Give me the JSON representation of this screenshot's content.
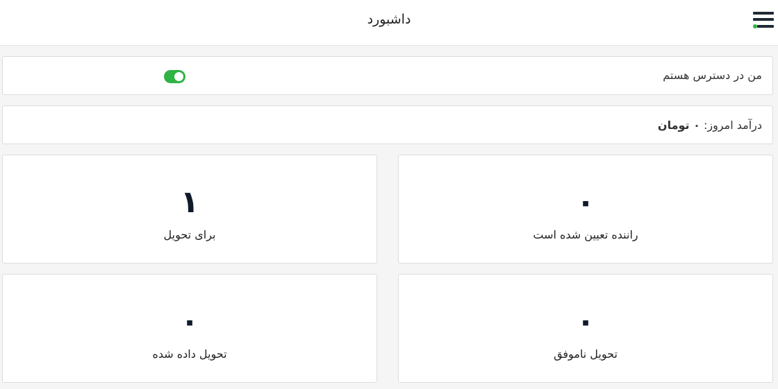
{
  "header": {
    "title": "داشبورد",
    "menu_icon": "hamburger-menu-icon",
    "status_dot_color": "#2fb344"
  },
  "availability": {
    "label": "من در دسترس هستم",
    "toggle_on": true,
    "toggle_color": "#2fb344"
  },
  "income": {
    "label": "درآمد امروز:",
    "amount": "۰ تومان"
  },
  "stats": [
    {
      "value": "۰",
      "label": "راننده تعیین شده است"
    },
    {
      "value": "۱",
      "label": "برای تحویل"
    },
    {
      "value": "۰",
      "label": "تحویل ناموفق"
    },
    {
      "value": "۰",
      "label": "تحویل داده شده"
    }
  ]
}
